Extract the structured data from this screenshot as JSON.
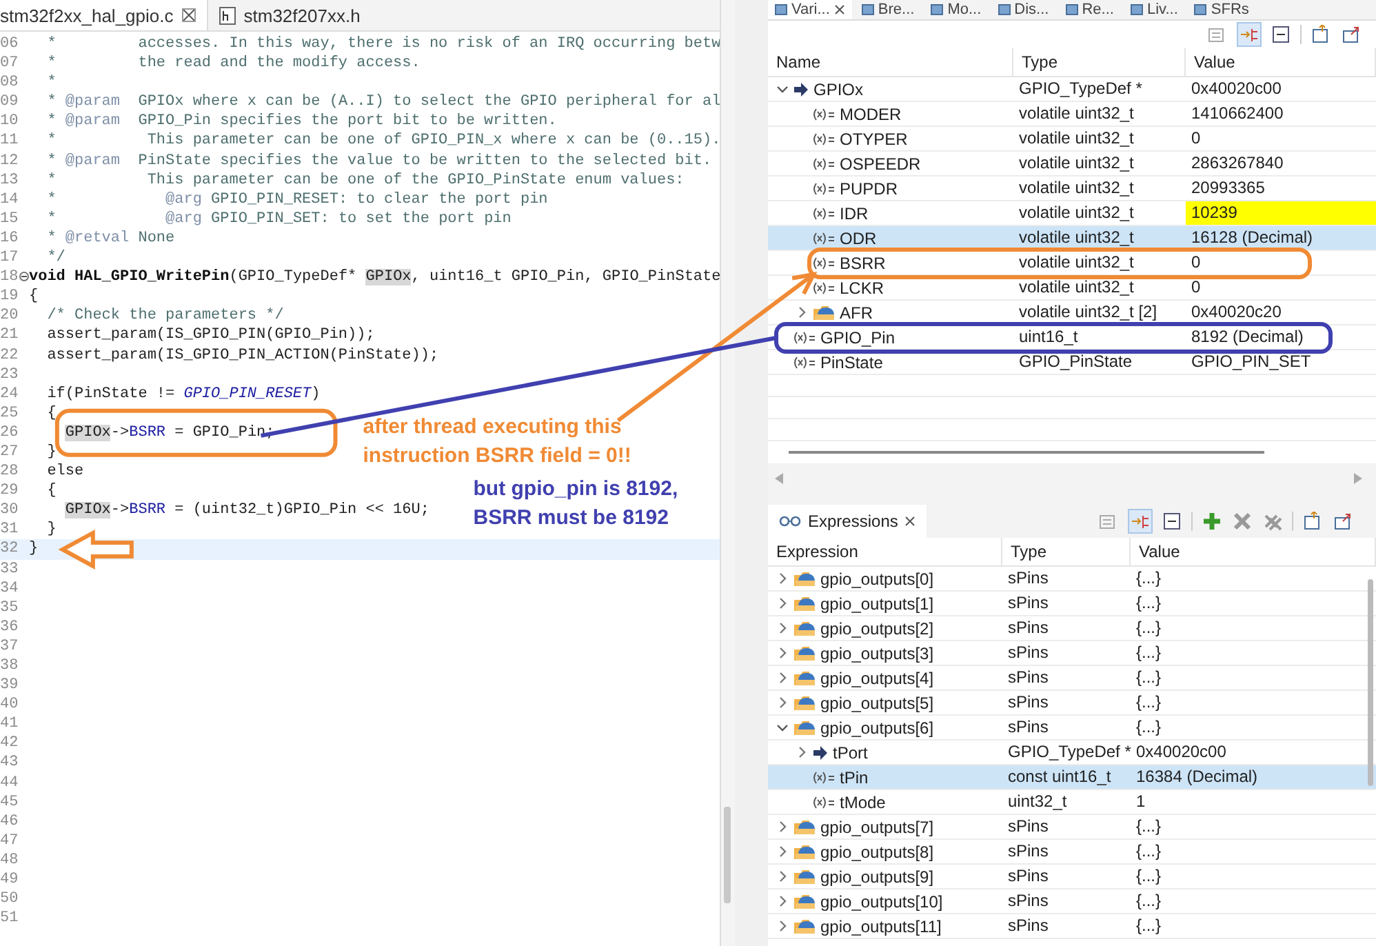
{
  "editor": {
    "tabs": [
      {
        "label": "stm32f2xx_hal_gpio.c",
        "kind": "source",
        "selected": true
      },
      {
        "label": "stm32f207xx.h",
        "kind": "header",
        "selected": false
      }
    ],
    "lines": [
      {
        "number": "06",
        "selected": false,
        "segments": [
          {
            "kind": "comment",
            "text": "  *         accesses. In this way, there is no risk of an IRQ occurring betw"
          }
        ]
      },
      {
        "number": "07",
        "selected": false,
        "segments": [
          {
            "kind": "comment",
            "text": "  *         the read and the modify access."
          }
        ]
      },
      {
        "number": "08",
        "selected": false,
        "segments": [
          {
            "kind": "comment",
            "text": "  *"
          }
        ]
      },
      {
        "number": "09",
        "selected": false,
        "segments": [
          {
            "kind": "comment",
            "text": "  * "
          },
          {
            "kind": "tag",
            "text": "@param"
          },
          {
            "kind": "comment",
            "text": "  GPIOx where x can be (A..I) to select the GPIO peripheral for al"
          }
        ]
      },
      {
        "number": "10",
        "selected": false,
        "segments": [
          {
            "kind": "comment",
            "text": "  * "
          },
          {
            "kind": "tag",
            "text": "@param"
          },
          {
            "kind": "comment",
            "text": "  GPIO_Pin specifies the port bit to be written."
          }
        ]
      },
      {
        "number": "11",
        "selected": false,
        "segments": [
          {
            "kind": "comment",
            "text": "  *          This parameter can be one of GPIO_PIN_x where x can be (0..15)."
          }
        ]
      },
      {
        "number": "12",
        "selected": false,
        "segments": [
          {
            "kind": "comment",
            "text": "  * "
          },
          {
            "kind": "tag",
            "text": "@param"
          },
          {
            "kind": "comment",
            "text": "  PinState specifies the value to be written to the selected bit."
          }
        ]
      },
      {
        "number": "13",
        "selected": false,
        "segments": [
          {
            "kind": "comment",
            "text": "  *          This parameter can be one of the GPIO_PinState enum values:"
          }
        ]
      },
      {
        "number": "14",
        "selected": false,
        "segments": [
          {
            "kind": "comment",
            "text": "  *            "
          },
          {
            "kind": "tag",
            "text": "@arg"
          },
          {
            "kind": "comment",
            "text": " GPIO_PIN_RESET: to clear the port pin"
          }
        ]
      },
      {
        "number": "15",
        "selected": false,
        "segments": [
          {
            "kind": "comment",
            "text": "  *            "
          },
          {
            "kind": "tag",
            "text": "@arg"
          },
          {
            "kind": "comment",
            "text": " GPIO_PIN_SET: to set the port pin"
          }
        ]
      },
      {
        "number": "16",
        "selected": false,
        "segments": [
          {
            "kind": "comment",
            "text": "  * "
          },
          {
            "kind": "tag",
            "text": "@retval"
          },
          {
            "kind": "comment",
            "text": " None"
          }
        ]
      },
      {
        "number": "17",
        "selected": false,
        "segments": [
          {
            "kind": "comment",
            "text": "  */"
          }
        ]
      },
      {
        "number": "18",
        "selected": false,
        "foldable": true,
        "segments": [
          {
            "kind": "keyword",
            "text": "void "
          },
          {
            "kind": "decl",
            "text": "HAL_GPIO_WritePin"
          },
          {
            "kind": "plain",
            "text": "(GPIO_TypeDef* "
          },
          {
            "kind": "occurrence",
            "text": "GPIOx"
          },
          {
            "kind": "plain",
            "text": ", uint16_t GPIO_Pin, GPIO_PinState"
          }
        ]
      },
      {
        "number": "19",
        "selected": false,
        "segments": [
          {
            "kind": "plain",
            "text": "{"
          }
        ]
      },
      {
        "number": "20",
        "selected": false,
        "segments": [
          {
            "kind": "comment",
            "text": "  /* Check the parameters */"
          }
        ]
      },
      {
        "number": "21",
        "selected": false,
        "segments": [
          {
            "kind": "plain",
            "text": "  assert_param(IS_GPIO_PIN(GPIO_Pin));"
          }
        ]
      },
      {
        "number": "22",
        "selected": false,
        "segments": [
          {
            "kind": "plain",
            "text": "  assert_param(IS_GPIO_PIN_ACTION(PinState));"
          }
        ]
      },
      {
        "number": "23",
        "selected": false
      },
      {
        "number": "24",
        "selected": false,
        "segments": [
          {
            "kind": "plain",
            "text": "  if(PinState != "
          },
          {
            "kind": "enum",
            "text": "GPIO_PIN_RESET"
          },
          {
            "kind": "plain",
            "text": ")"
          }
        ]
      },
      {
        "number": "25",
        "selected": false,
        "segments": [
          {
            "kind": "plain",
            "text": "  {"
          }
        ]
      },
      {
        "number": "26",
        "selected": false,
        "segments": [
          {
            "kind": "occurrence",
            "text": "    GPIOx"
          },
          {
            "kind": "plain",
            "text": "->"
          },
          {
            "kind": "field",
            "text": "BSRR"
          },
          {
            "kind": "plain",
            "text": " = GPIO_Pin;"
          }
        ]
      },
      {
        "number": "27",
        "selected": false,
        "segments": [
          {
            "kind": "plain",
            "text": "  }"
          }
        ]
      },
      {
        "number": "28",
        "selected": false,
        "segments": [
          {
            "kind": "plain",
            "text": "  else"
          }
        ]
      },
      {
        "number": "29",
        "selected": false,
        "segments": [
          {
            "kind": "plain",
            "text": "  {"
          }
        ]
      },
      {
        "number": "30",
        "selected": false,
        "segments": [
          {
            "kind": "occurrence",
            "text": "    GPIOx"
          },
          {
            "kind": "plain",
            "text": "->"
          },
          {
            "kind": "field",
            "text": "BSRR"
          },
          {
            "kind": "plain",
            "text": " = (uint32_t)GPIO_Pin << 16U;"
          }
        ]
      },
      {
        "number": "31",
        "selected": false,
        "segments": [
          {
            "kind": "plain",
            "text": "  }"
          }
        ]
      },
      {
        "number": "32",
        "selected": true,
        "segments": [
          {
            "kind": "plain",
            "text": "}"
          }
        ]
      },
      {
        "number": "33",
        "selected": false
      },
      {
        "number": "34",
        "selected": false
      },
      {
        "number": "35",
        "selected": false
      },
      {
        "number": "36",
        "selected": false
      },
      {
        "number": "37",
        "selected": false
      },
      {
        "number": "38",
        "selected": false
      },
      {
        "number": "39",
        "selected": false
      },
      {
        "number": "40",
        "selected": false
      },
      {
        "number": "41",
        "selected": false
      },
      {
        "number": "42",
        "selected": false
      },
      {
        "number": "43",
        "selected": false
      },
      {
        "number": "44",
        "selected": false
      },
      {
        "number": "45",
        "selected": false
      },
      {
        "number": "46",
        "selected": false
      },
      {
        "number": "47",
        "selected": false
      },
      {
        "number": "48",
        "selected": false
      },
      {
        "number": "49",
        "selected": false
      },
      {
        "number": "50",
        "selected": false
      },
      {
        "number": "51",
        "selected": false
      }
    ]
  },
  "variables": {
    "tabs": [
      {
        "label": "Vari...",
        "selected": true
      },
      {
        "label": "Bre...",
        "selected": false
      },
      {
        "label": "Mo...",
        "selected": false
      },
      {
        "label": "Dis...",
        "selected": false
      },
      {
        "label": "Re...",
        "selected": false
      },
      {
        "label": "Liv...",
        "selected": false
      },
      {
        "label": "SFRs",
        "selected": false
      }
    ],
    "columns": [
      "Name",
      "Type",
      "Value"
    ],
    "rows": [
      {
        "name": "GPIOx",
        "type": "GPIO_TypeDef *",
        "value": "0x40020c00",
        "kind": "pointer",
        "expanded": true,
        "selected": false,
        "changed": false,
        "children": [
          {
            "name": "MODER",
            "type": "volatile uint32_t",
            "value": "1410662400",
            "kind": "variable",
            "selected": false,
            "changed": false
          },
          {
            "name": "OTYPER",
            "type": "volatile uint32_t",
            "value": "0",
            "kind": "variable",
            "selected": false,
            "changed": false
          },
          {
            "name": "OSPEEDR",
            "type": "volatile uint32_t",
            "value": "2863267840",
            "kind": "variable",
            "selected": false,
            "changed": false
          },
          {
            "name": "PUPDR",
            "type": "volatile uint32_t",
            "value": "20993365",
            "kind": "variable",
            "selected": false,
            "changed": false
          },
          {
            "name": "IDR",
            "type": "volatile uint32_t",
            "value": "10239",
            "kind": "variable",
            "selected": false,
            "changed": true
          },
          {
            "name": "ODR",
            "type": "volatile uint32_t",
            "value": "16128 (Decimal)",
            "kind": "variable",
            "selected": true,
            "changed": false
          },
          {
            "name": "BSRR",
            "type": "volatile uint32_t",
            "value": "0",
            "kind": "variable",
            "selected": false,
            "changed": false
          },
          {
            "name": "LCKR",
            "type": "volatile uint32_t",
            "value": "0",
            "kind": "variable",
            "selected": false,
            "changed": false
          },
          {
            "name": "AFR",
            "type": "volatile uint32_t [2]",
            "value": "0x40020c20",
            "kind": "struct",
            "expanded": false,
            "selected": false,
            "changed": false
          }
        ]
      },
      {
        "name": "GPIO_Pin",
        "type": "uint16_t",
        "value": "8192 (Decimal)",
        "kind": "variable",
        "selected": false,
        "changed": false
      },
      {
        "name": "PinState",
        "type": "GPIO_PinState",
        "value": "GPIO_PIN_SET",
        "kind": "variable",
        "selected": false,
        "changed": false
      }
    ]
  },
  "expressions": {
    "tab": "Expressions",
    "columns": [
      "Expression",
      "Type",
      "Value"
    ],
    "rows": [
      {
        "name": "gpio_outputs[0]",
        "type": "sPins",
        "value": "{...}",
        "kind": "struct",
        "expanded": false,
        "selected": false
      },
      {
        "name": "gpio_outputs[1]",
        "type": "sPins",
        "value": "{...}",
        "kind": "struct",
        "expanded": false,
        "selected": false
      },
      {
        "name": "gpio_outputs[2]",
        "type": "sPins",
        "value": "{...}",
        "kind": "struct",
        "expanded": false,
        "selected": false
      },
      {
        "name": "gpio_outputs[3]",
        "type": "sPins",
        "value": "{...}",
        "kind": "struct",
        "expanded": false,
        "selected": false
      },
      {
        "name": "gpio_outputs[4]",
        "type": "sPins",
        "value": "{...}",
        "kind": "struct",
        "expanded": false,
        "selected": false
      },
      {
        "name": "gpio_outputs[5]",
        "type": "sPins",
        "value": "{...}",
        "kind": "struct",
        "expanded": false,
        "selected": false
      },
      {
        "name": "gpio_outputs[6]",
        "type": "sPins",
        "value": "{...}",
        "kind": "struct",
        "expanded": true,
        "selected": false,
        "children": [
          {
            "name": "tPort",
            "type": "GPIO_TypeDef *",
            "value": "0x40020c00",
            "kind": "pointer",
            "expanded": false,
            "selected": false
          },
          {
            "name": "tPin",
            "type": "const uint16_t",
            "value": "16384 (Decimal)",
            "kind": "variable",
            "selected": true
          },
          {
            "name": "tMode",
            "type": "uint32_t",
            "value": "1",
            "kind": "variable",
            "selected": false
          }
        ]
      },
      {
        "name": "gpio_outputs[7]",
        "type": "sPins",
        "value": "{...}",
        "kind": "struct",
        "expanded": false,
        "selected": false
      },
      {
        "name": "gpio_outputs[8]",
        "type": "sPins",
        "value": "{...}",
        "kind": "struct",
        "expanded": false,
        "selected": false
      },
      {
        "name": "gpio_outputs[9]",
        "type": "sPins",
        "value": "{...}",
        "kind": "struct",
        "expanded": false,
        "selected": false
      },
      {
        "name": "gpio_outputs[10]",
        "type": "sPins",
        "value": "{...}",
        "kind": "struct",
        "expanded": false,
        "selected": false
      },
      {
        "name": "gpio_outputs[11]",
        "type": "sPins",
        "value": "{...}",
        "kind": "struct",
        "expanded": false,
        "selected": false
      }
    ]
  },
  "annotations": [
    {
      "kind": "box",
      "color": "#f08a34"
    },
    {
      "kind": "arrow",
      "color": "#f08a34"
    },
    {
      "kind": "box",
      "color": "#f08a34"
    },
    {
      "kind": "line",
      "color": "#4040b0"
    },
    {
      "kind": "box",
      "color": "#4040b0"
    },
    {
      "kind": "hollow-arrow",
      "color": "#f08a34"
    },
    {
      "kind": "note",
      "text": "after thread executing this\ninstruction BSRR field = 0!!",
      "color": "#f08a34"
    },
    {
      "kind": "note",
      "text": "but gpio_pin is 8192,\nBSRR must be 8192",
      "color": "#4040b0"
    }
  ]
}
